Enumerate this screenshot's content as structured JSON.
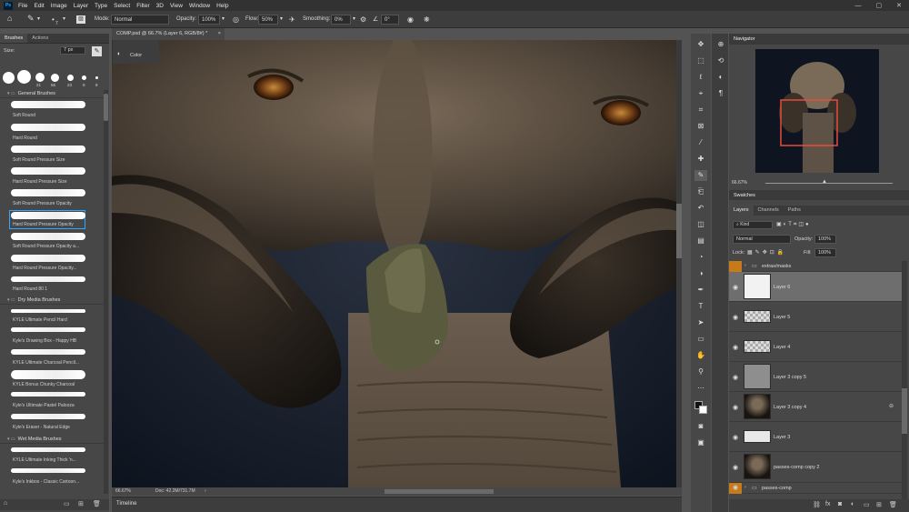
{
  "menu": [
    "File",
    "Edit",
    "Image",
    "Layer",
    "Type",
    "Select",
    "Filter",
    "3D",
    "View",
    "Window",
    "Help"
  ],
  "app_logo": "Ps",
  "options": {
    "size_value": "7",
    "mode_label": "Mode:",
    "mode_value": "Normal",
    "opacity_label": "Opacity:",
    "opacity_value": "100%",
    "flow_label": "Flow:",
    "flow_value": "50%",
    "smoothing_label": "Smoothing:",
    "smoothing_value": "0%",
    "angle_value": "0°"
  },
  "brushes_panel": {
    "tabs": [
      "Brushes",
      "Actions"
    ],
    "size_label": "Size:",
    "size_value": "7 px",
    "presets": [
      "21",
      "56",
      "23",
      "9",
      "8"
    ],
    "groups": [
      {
        "name": "General Brushes",
        "brushes": [
          "Soft Round",
          "Hard Round",
          "Soft Round Pressure Size",
          "Hard Round Pressure Size",
          "Soft Round Pressure Opacity",
          "Hard Round Pressure Opacity",
          "Soft Round Pressure Opacity a...",
          "Hard Round Pressure Opacity...",
          "Hard Round 80 1"
        ]
      },
      {
        "name": "Dry Media Brushes",
        "brushes": [
          "KYLE Ultimate Pencil Hard",
          "Kyle's Drawing Box - Happy HB",
          "KYLE Ultimate Charcoal Pencil...",
          "KYLE Bonus Chunky Charcoal",
          "Kyle's Ultimate Pastel Palooza",
          "Kyle's Eraser - Natural Edge"
        ]
      },
      {
        "name": "Wet Media Brushes",
        "brushes": [
          "KYLE Ultimate Inking Thick 'n...",
          "Kyle's Inkbox - Classic Cartoon..."
        ]
      }
    ]
  },
  "document": {
    "tab_title": "COMP.psd @ 66.7% (Layer 6, RGB/8#) *",
    "color_panel_label": "Color",
    "zoom": "66.67%",
    "doc_size": "Doc: 42.2M/731.7M"
  },
  "timeline_label": "Timeline",
  "navigator": {
    "title": "Navigator",
    "zoom": "66.67%"
  },
  "swatches_title": "Swatches",
  "layers_panel": {
    "tabs": [
      "Layers",
      "Channels",
      "Paths"
    ],
    "kind_label": "Kind",
    "blend_mode": "Normal",
    "opacity_label": "Opacity:",
    "opacity_value": "100%",
    "lock_label": "Lock:",
    "fill_label": "Fill:",
    "fill_value": "100%",
    "layers": [
      {
        "name": "extras/masks",
        "type": "group",
        "selected": false
      },
      {
        "name": "Layer 6",
        "type": "white",
        "selected": true
      },
      {
        "name": "Layer 5",
        "type": "strip"
      },
      {
        "name": "Layer 4",
        "type": "strip"
      },
      {
        "name": "Layer 3 copy 5",
        "type": "gray"
      },
      {
        "name": "Layer 3 copy 4",
        "type": "image"
      },
      {
        "name": "Layer 3",
        "type": "strip"
      },
      {
        "name": "passes-comp copy 2",
        "type": "image"
      },
      {
        "name": "passes-comp",
        "type": "group"
      }
    ]
  },
  "colors": {
    "accent": "#31a8ff",
    "selection": "#5d5d5d",
    "highlight_orange": "#c77a1a"
  }
}
